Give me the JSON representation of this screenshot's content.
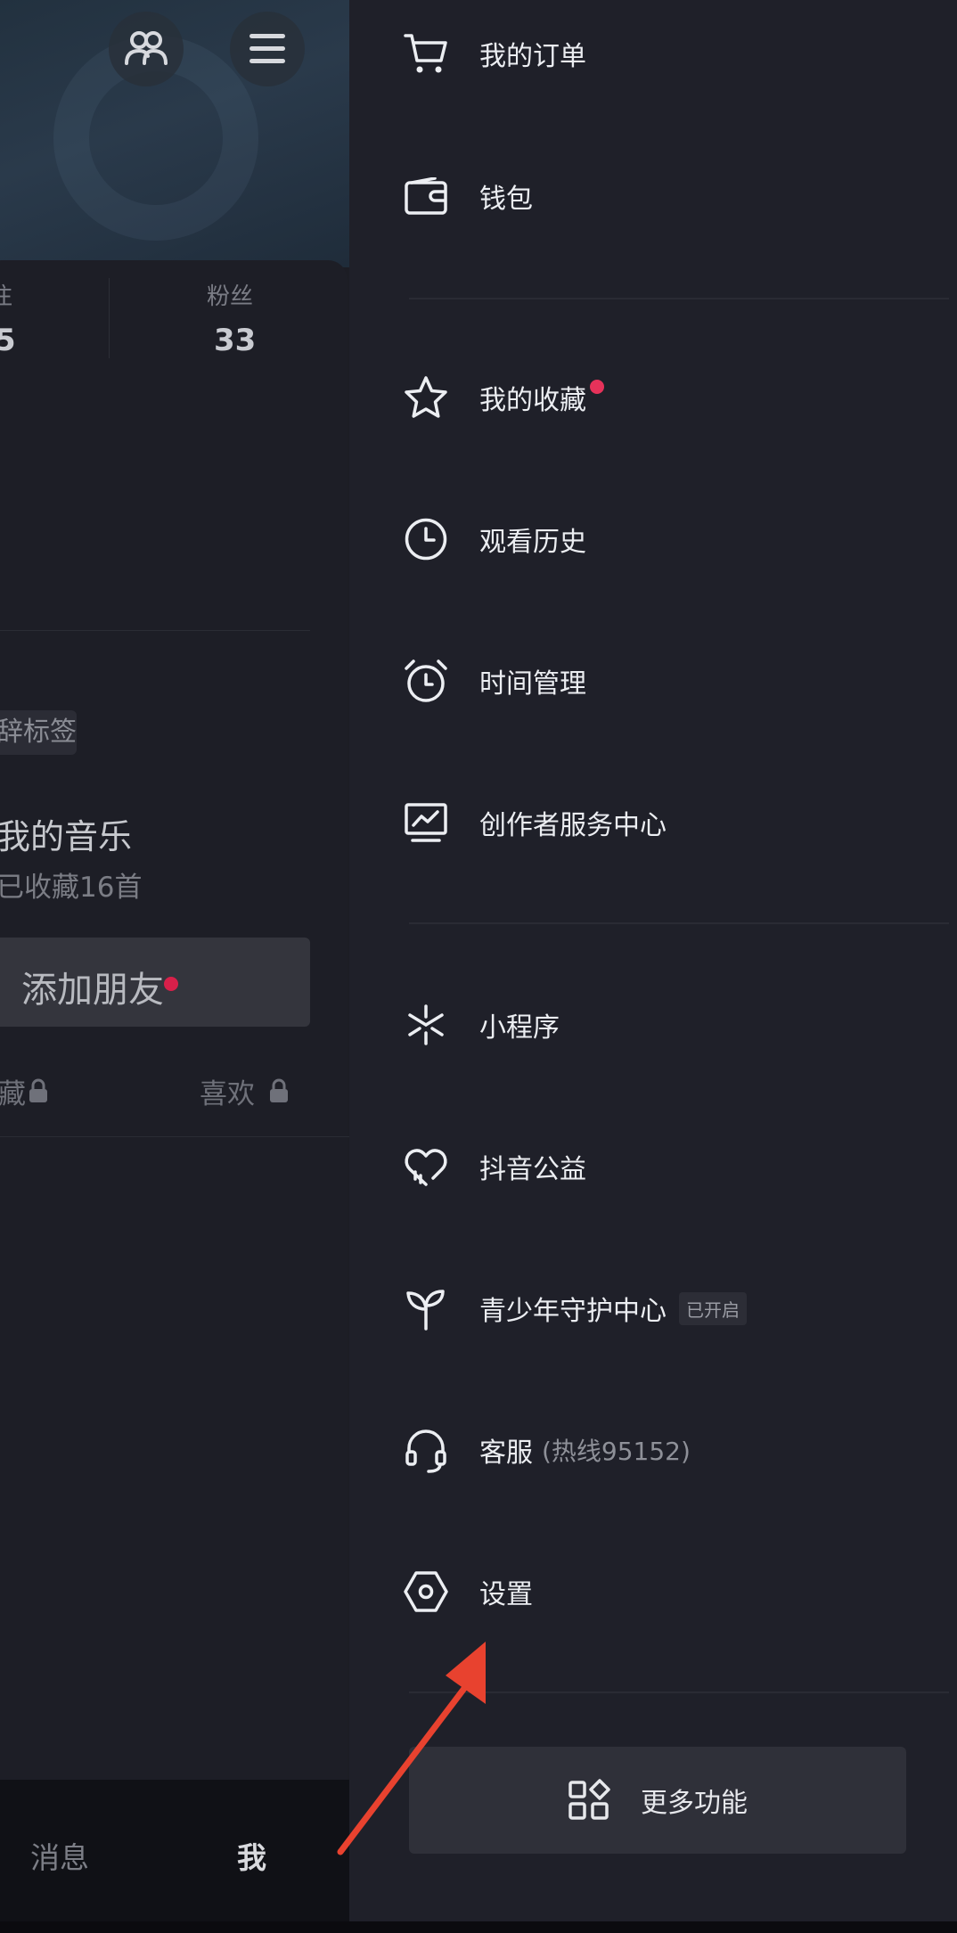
{
  "left_panel": {
    "stats": [
      {
        "label": "注",
        "value": "5"
      },
      {
        "label": "粉丝",
        "value": "33"
      }
    ],
    "tag_chip": "辞标签",
    "music_title": "我的音乐",
    "music_subtitle": "已收藏16首",
    "add_friend_label": "添加朋友",
    "tabs": {
      "favorites": "藏",
      "likes": "喜欢"
    },
    "bottom_nav": {
      "messages": "消息",
      "me": "我"
    }
  },
  "drawer": {
    "group1": [
      {
        "label": "我的订单",
        "icon": "cart-icon"
      },
      {
        "label": "钱包",
        "icon": "wallet-icon"
      }
    ],
    "group2": [
      {
        "label": "我的收藏",
        "icon": "star-icon",
        "dot": true
      },
      {
        "label": "观看历史",
        "icon": "clock-icon"
      },
      {
        "label": "时间管理",
        "icon": "alarm-clock-icon"
      },
      {
        "label": "创作者服务中心",
        "icon": "chart-monitor-icon"
      }
    ],
    "group3": [
      {
        "label": "小程序",
        "icon": "mini-program-icon"
      },
      {
        "label": "抖音公益",
        "icon": "charity-heart-icon"
      },
      {
        "label": "青少年守护中心",
        "icon": "sprout-icon",
        "badge": "已开启"
      },
      {
        "label": "客服",
        "extra": "(热线95152)",
        "icon": "headset-icon"
      },
      {
        "label": "设置",
        "icon": "settings-hexagon-icon"
      }
    ],
    "more_button": "更多功能"
  },
  "colors": {
    "accent_red": "#e6325a",
    "drawer_bg": "#1f2029",
    "annotation_arrow": "#e8422f"
  }
}
